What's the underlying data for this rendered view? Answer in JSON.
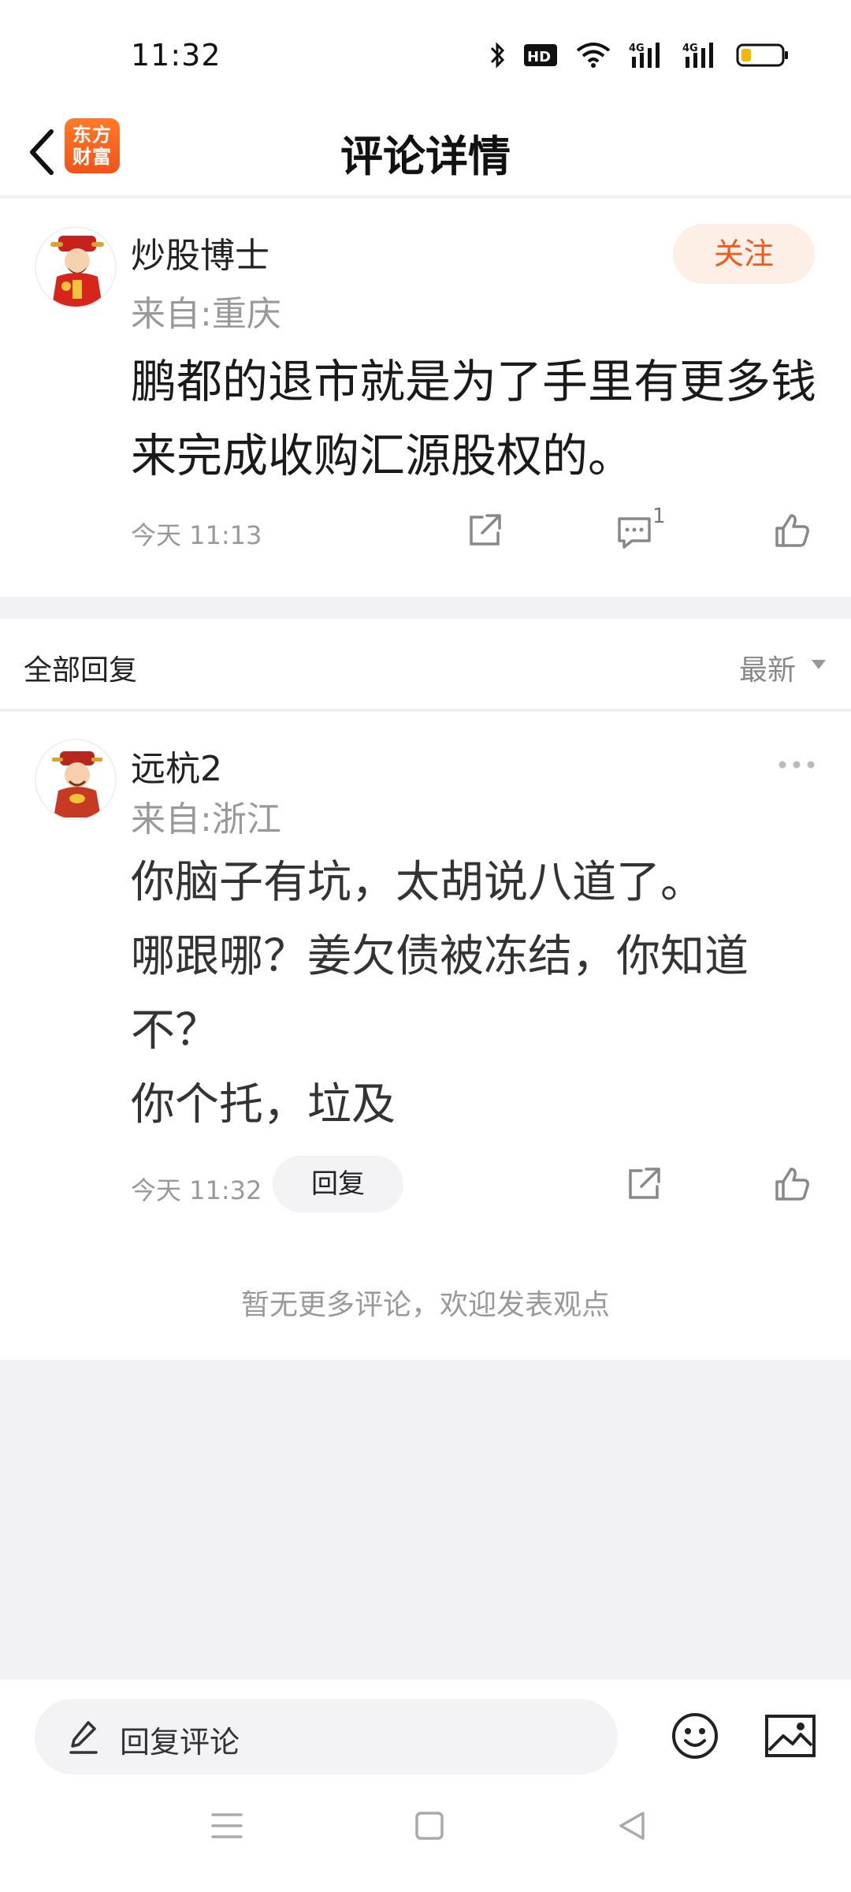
{
  "status_bar": {
    "time": "11:32",
    "icons": [
      "bluetooth-icon",
      "hd-icon",
      "wifi-icon",
      "signal-4g-icon",
      "signal-4g-icon",
      "battery-icon"
    ]
  },
  "header": {
    "title": "评论详情",
    "logo_text": "东方\n财富",
    "back_icon": "chevron-left-icon"
  },
  "comment": {
    "username": "炒股博士",
    "location": "来自:重庆",
    "follow_label": "关注",
    "text": "鹏都的退市就是为了手里有更多钱来完成收购汇源股权的。",
    "time": "今天 11:13",
    "reply_count": "1"
  },
  "replies_header": {
    "title": "全部回复",
    "sort_label": "最新"
  },
  "reply": {
    "username": "远杭2",
    "location": "来自:浙江",
    "text": "你脑子有坑，太胡说八道了。\n哪跟哪？姜欠债被冻结，你知道不？\n你个托，垃及",
    "time": "今天 11:32",
    "reply_button": "回复"
  },
  "footer_note": "暂无更多评论，欢迎发表观点",
  "bottom_bar": {
    "input_label": "回复评论"
  },
  "colors": {
    "accent": "#f05a1c",
    "follow_bg": "#fdeee6",
    "page_bg": "#f2f2f4"
  }
}
